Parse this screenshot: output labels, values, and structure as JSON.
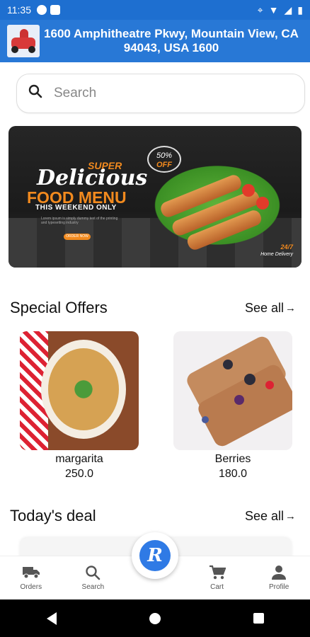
{
  "status_bar": {
    "time": "11:35"
  },
  "header": {
    "address": "1600 Amphitheatre Pkwy, Mountain View, CA 94043, USA 1600"
  },
  "search": {
    "placeholder": "Search"
  },
  "banner": {
    "super": "SUPER",
    "title": "Delicious",
    "menu": "FOOD MENU",
    "subtitle": "THIS WEEKEND ONLY",
    "body": "Lorem ipsum is simply dummy text of the printing and typesetting industry",
    "button": "ORDER NOW",
    "badge_pct": "50%",
    "badge_off": "OFF",
    "delivery_top": "24/7",
    "delivery_bottom": "Home Delivery"
  },
  "special_offers": {
    "title": "Special Offers",
    "see_all": "See all",
    "items": [
      {
        "name": "margarita",
        "price": "250.0"
      },
      {
        "name": "Berries",
        "price": "180.0"
      }
    ]
  },
  "todays_deal": {
    "title": "Today's deal",
    "see_all": "See all"
  },
  "bottom_nav": {
    "orders": "Orders",
    "search": "Search",
    "cart": "Cart",
    "profile": "Profile",
    "fab_letter": "R"
  },
  "colors": {
    "header_blue": "#2878d6",
    "accent_orange": "#f28a1e"
  }
}
